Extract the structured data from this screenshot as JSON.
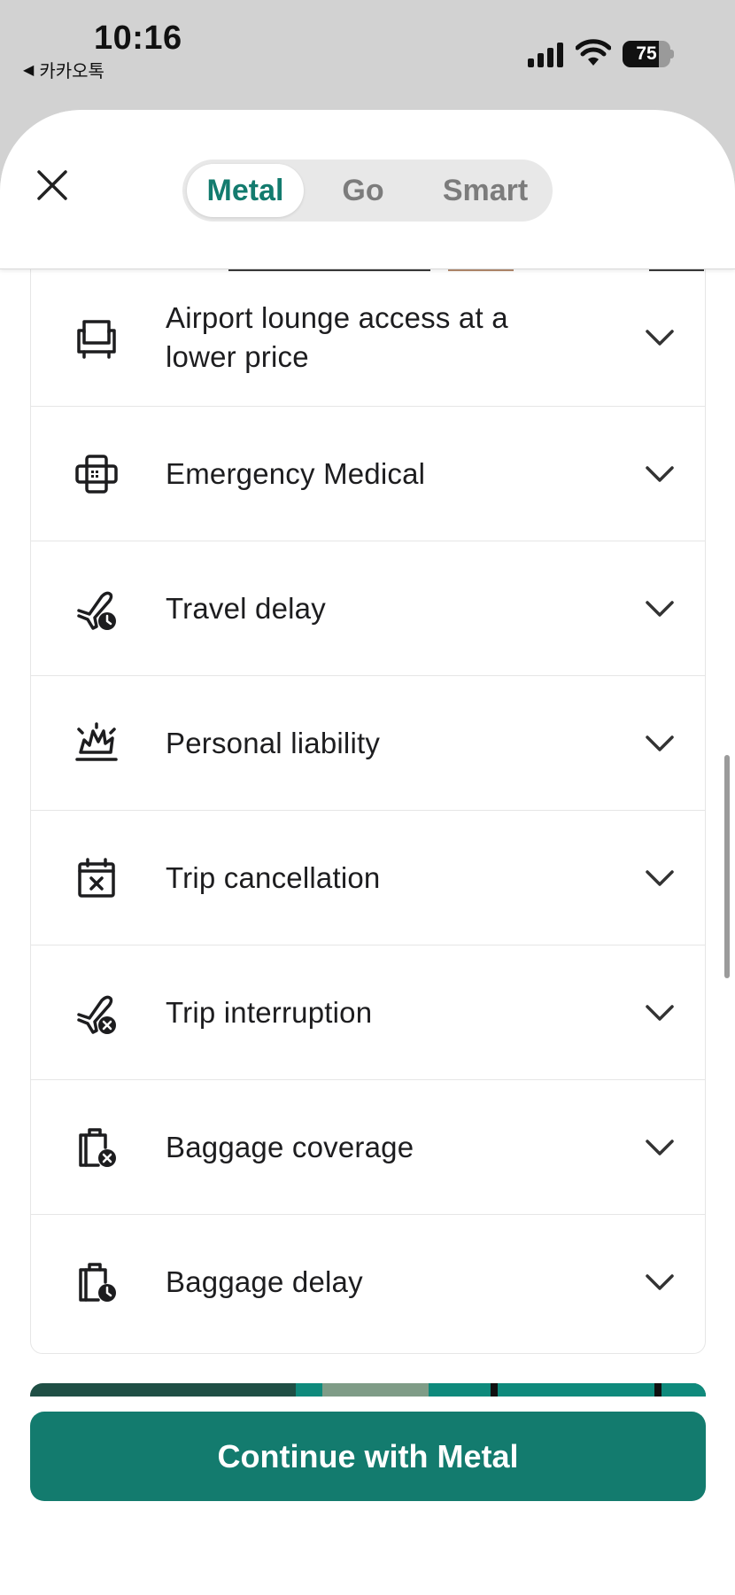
{
  "status_bar": {
    "time": "10:16",
    "back_app": "카카오톡",
    "back_arrow_icon": "back-triangle-icon",
    "signal_icon": "cellular-signal-icon",
    "wifi_icon": "wifi-icon",
    "battery_percent": "75",
    "battery_level": 0.75
  },
  "header": {
    "close_icon": "close-icon",
    "plans": [
      {
        "label": "Metal",
        "active": true
      },
      {
        "label": "Go",
        "active": false
      },
      {
        "label": "Smart",
        "active": false
      }
    ]
  },
  "benefits": [
    {
      "label": "Airport lounge access at a lower price",
      "icon": "armchair-icon"
    },
    {
      "label": "Emergency Medical",
      "icon": "medical-kit-icon"
    },
    {
      "label": "Travel delay",
      "icon": "plane-clock-icon"
    },
    {
      "label": "Personal liability",
      "icon": "liability-burst-icon"
    },
    {
      "label": "Trip cancellation",
      "icon": "calendar-x-icon"
    },
    {
      "label": "Trip interruption",
      "icon": "plane-x-icon"
    },
    {
      "label": "Baggage coverage",
      "icon": "luggage-x-icon"
    },
    {
      "label": "Baggage delay",
      "icon": "luggage-clock-icon"
    }
  ],
  "cta": {
    "label": "Continue with Metal"
  },
  "colors": {
    "accent": "#137b6e",
    "inactive_tab": "#7c7c7c",
    "sheet_bg": "#ffffff",
    "status_bg": "#d2d2d2"
  }
}
